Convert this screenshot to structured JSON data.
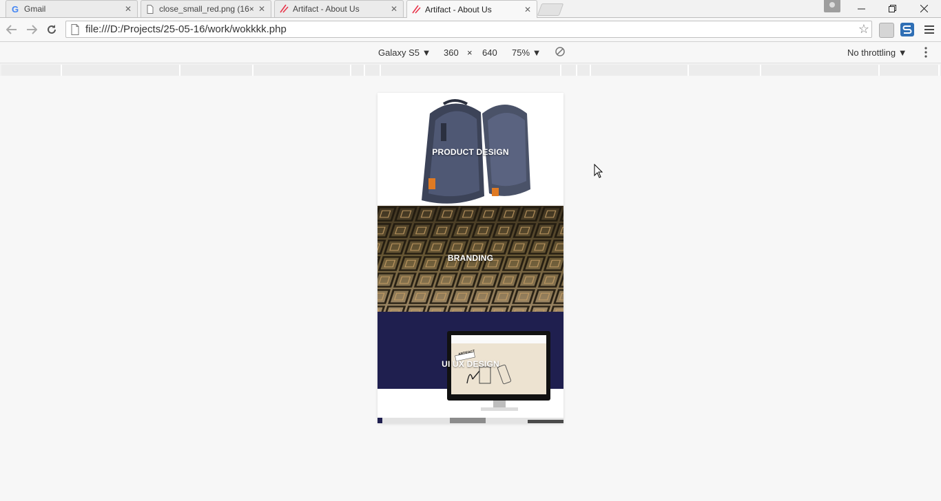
{
  "browser": {
    "tabs": [
      {
        "title": "Gmail",
        "favicon": "google-g-icon"
      },
      {
        "title": "close_small_red.png (16×",
        "favicon": "file-icon"
      },
      {
        "title": "Artifact - About Us",
        "favicon": "artifact-logo-icon"
      },
      {
        "title": "Artifact - About Us",
        "favicon": "artifact-logo-icon",
        "active": true
      }
    ],
    "address": "file:///D:/Projects/25-05-16/work/wokkkk.php"
  },
  "device_toolbar": {
    "device": "Galaxy S5",
    "width": "360",
    "times": "×",
    "height": "640",
    "zoom": "75%",
    "throttling": "No throttling"
  },
  "site": {
    "tiles": [
      {
        "label": "PRODUCT DESIGN"
      },
      {
        "label": "BRANDING"
      },
      {
        "label": "UI UX DESIGN"
      }
    ],
    "screen_badge": "ARTIFACT",
    "brand_color": "#1f1f4f"
  }
}
